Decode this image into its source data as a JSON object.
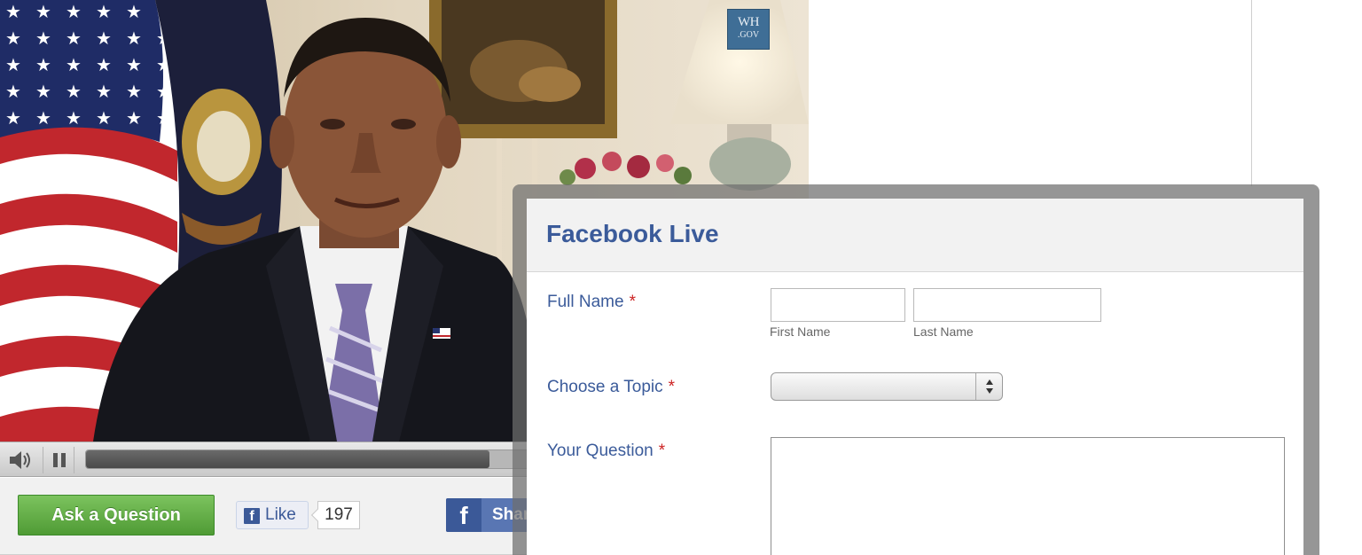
{
  "video": {
    "logo_line1": "WH",
    "logo_line2": ".GOV",
    "progress_fraction": 0.57
  },
  "actions": {
    "ask_label": "Ask a Question",
    "like_label": "Like",
    "like_count": "197",
    "share_label": "Share",
    "share_icon": "f"
  },
  "form": {
    "title": "Facebook Live",
    "required_mark": "*",
    "fields": {
      "full_name": {
        "label": "Full Name",
        "first_sublabel": "First Name",
        "last_sublabel": "Last Name",
        "first_value": "",
        "last_value": ""
      },
      "topic": {
        "label": "Choose a Topic",
        "selected": ""
      },
      "question": {
        "label": "Your Question",
        "value": ""
      }
    }
  },
  "colors": {
    "form_label": "#3b5b9a",
    "required": "#cc2222",
    "ask_button": "#5fae42",
    "facebook_blue": "#3b5998"
  },
  "icons": [
    "speaker-icon",
    "pause-icon",
    "facebook-f-icon"
  ]
}
